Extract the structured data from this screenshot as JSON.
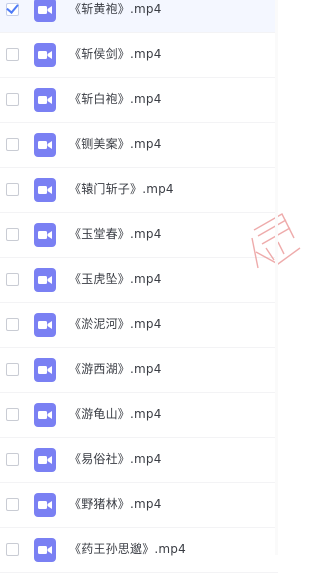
{
  "files": [
    {
      "name": "《斩黄袍》.mp4",
      "selected": true
    },
    {
      "name": "《斩侯剑》.mp4",
      "selected": false
    },
    {
      "name": "《斩白袍》.mp4",
      "selected": false
    },
    {
      "name": "《铡美案》.mp4",
      "selected": false
    },
    {
      "name": "《辕门斩子》.mp4",
      "selected": false
    },
    {
      "name": "《玉堂春》.mp4",
      "selected": false
    },
    {
      "name": "《玉虎坠》.mp4",
      "selected": false
    },
    {
      "name": "《淤泥河》.mp4",
      "selected": false
    },
    {
      "name": "《游西湖》.mp4",
      "selected": false
    },
    {
      "name": "《游龟山》.mp4",
      "selected": false
    },
    {
      "name": "《易俗社》.mp4",
      "selected": false
    },
    {
      "name": "《野猪林》.mp4",
      "selected": false
    },
    {
      "name": "《药王孙思邈》.mp4",
      "selected": false
    }
  ],
  "icons": {
    "file_type": "video-icon",
    "selection": "checkmark-icon"
  },
  "colors": {
    "icon_bg": "#7a80f3",
    "check": "#4f7cf7",
    "text": "#3a3d44",
    "watermark": "#e98f8f"
  }
}
